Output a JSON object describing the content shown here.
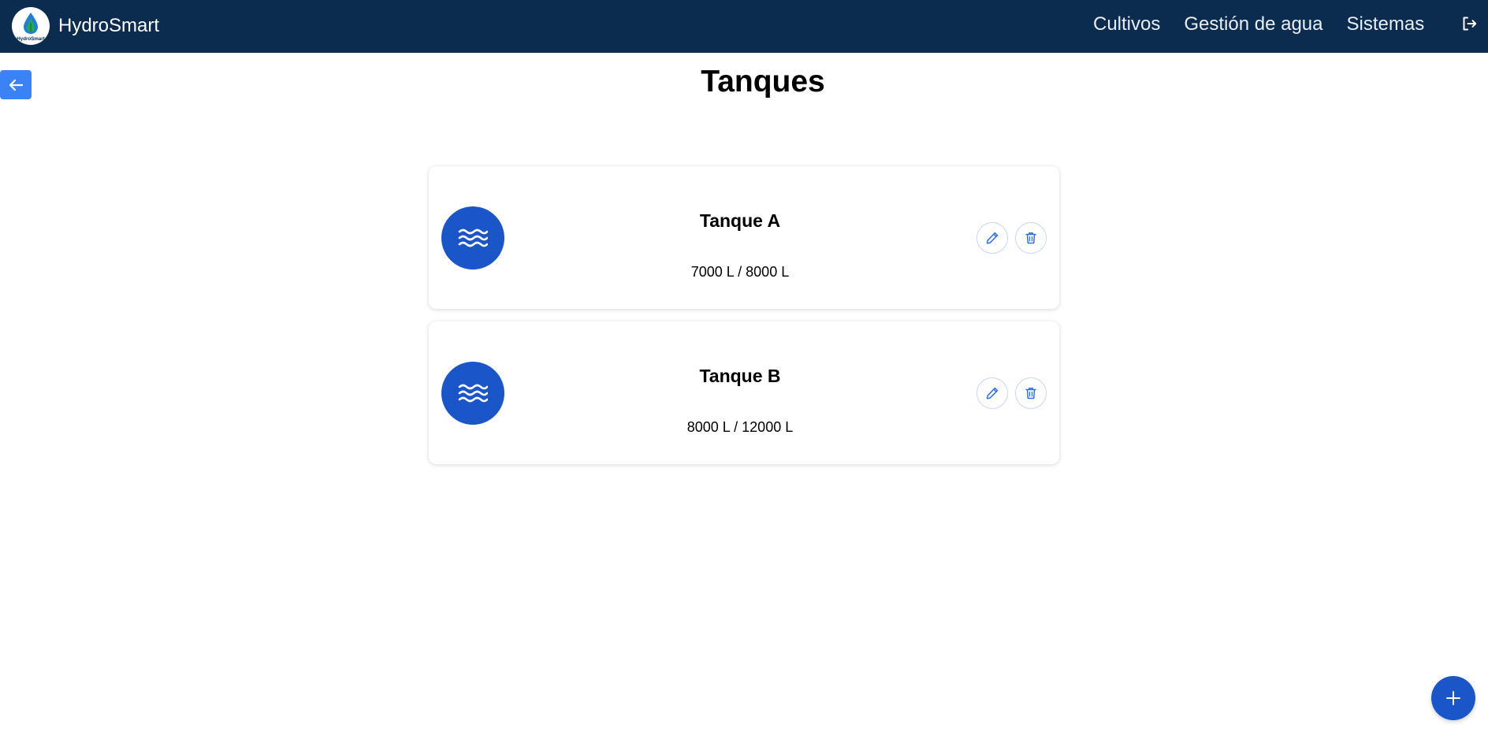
{
  "header": {
    "brand_name": "HydroSmart",
    "logo_text": "HydroSmart",
    "nav": [
      "Cultivos",
      "Gestión de agua",
      "Sistemas"
    ],
    "logout_icon": "logout-icon"
  },
  "page": {
    "title": "Tanques",
    "back_icon": "arrow-left-icon"
  },
  "tanks": [
    {
      "name": "Tanque A",
      "volume": "7000 L / 8000 L",
      "icon": "water-waves-icon"
    },
    {
      "name": "Tanque B",
      "volume": "8000 L / 12000 L",
      "icon": "water-waves-icon"
    }
  ],
  "actions": {
    "edit_icon": "pencil-icon",
    "delete_icon": "trash-icon",
    "add_icon": "plus-icon"
  },
  "colors": {
    "navbar": "#0b2b4f",
    "accent": "#1a56c8",
    "back_button": "#3b82f6"
  }
}
